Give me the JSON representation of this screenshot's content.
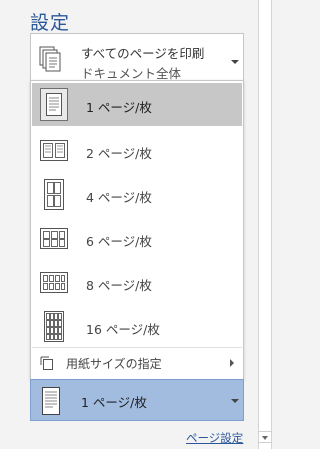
{
  "settings": {
    "title": "設定",
    "print_pages": {
      "main": "すべてのページを印刷",
      "sub": "ドキュメント全体"
    },
    "pages_per_sheet": {
      "options": [
        {
          "label": "1 ページ/枚",
          "icon": "pages-1-icon",
          "selected": true
        },
        {
          "label": "2 ページ/枚",
          "icon": "pages-2-icon",
          "selected": false
        },
        {
          "label": "4 ページ/枚",
          "icon": "pages-4-icon",
          "selected": false
        },
        {
          "label": "6 ページ/枚",
          "icon": "pages-6-icon",
          "selected": false
        },
        {
          "label": "8 ページ/枚",
          "icon": "pages-8-icon",
          "selected": false
        },
        {
          "label": "16 ページ/枚",
          "icon": "pages-16-icon",
          "selected": false
        }
      ],
      "scale_to_paper": "用紙サイズの指定",
      "current": "1 ページ/枚"
    },
    "page_setup_link": "ページ設定"
  },
  "colors": {
    "accent": "#2b579a",
    "selected_item": "#c7c7c7",
    "selected_box": "#a2bce0"
  }
}
